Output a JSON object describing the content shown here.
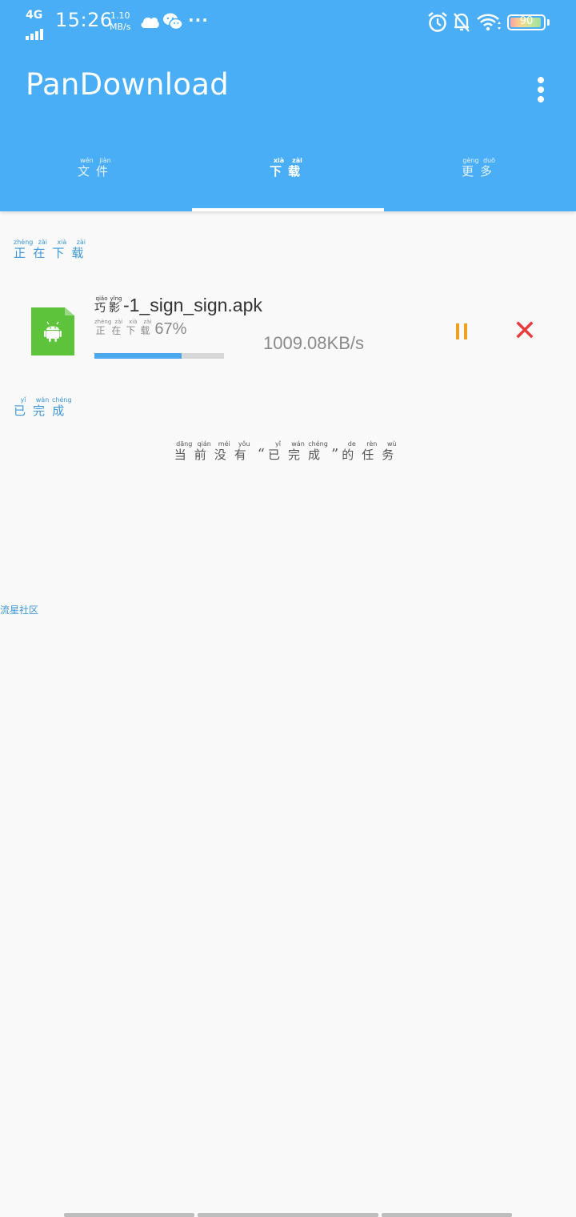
{
  "status_bar": {
    "network": "4G",
    "time": "15:26",
    "speed_value": "1.10",
    "speed_unit": "MB/s",
    "more": "···",
    "battery_level": "90"
  },
  "app": {
    "title": "PanDownload",
    "accent_color": "#4aaef7"
  },
  "tabs": [
    {
      "chars": [
        "文",
        "件"
      ],
      "pinyin": [
        "wén",
        "jiàn"
      ]
    },
    {
      "chars": [
        "下",
        "载"
      ],
      "pinyin": [
        "xià",
        "zài"
      ],
      "active": true
    },
    {
      "chars": [
        "更",
        "多"
      ],
      "pinyin": [
        "gèng",
        "duō"
      ]
    }
  ],
  "downloading": {
    "heading_chars": [
      "正",
      "在",
      "下",
      "载"
    ],
    "heading_pinyin": [
      "zhèng",
      "zài",
      "xià",
      "zài"
    ],
    "items": [
      {
        "name_chars": [
          "巧",
          "影"
        ],
        "name_pinyin": [
          "qiǎo",
          "yǐng"
        ],
        "name_suffix": "-1_sign_sign.apk",
        "status_chars": [
          "正",
          "在",
          "下",
          "载"
        ],
        "status_pinyin": [
          "zhèng",
          "zài",
          "xià",
          "zài"
        ],
        "percent_text": "67%",
        "progress": 0.67,
        "speed": "1009.08KB/s",
        "file_icon": "android-apk-icon",
        "pause_icon": "pause-icon",
        "cancel_icon": "close-icon"
      }
    ]
  },
  "completed": {
    "heading_chars": [
      "已",
      "完",
      "成"
    ],
    "heading_pinyin": [
      "yǐ",
      "wán",
      "chéng"
    ],
    "empty": {
      "pre_chars": [
        "当",
        "前",
        "没",
        "有"
      ],
      "pre_pinyin": [
        "dāng",
        "qián",
        "méi",
        "yǒu"
      ],
      "open_quote": "“",
      "quoted_chars": [
        "已",
        "完",
        "成"
      ],
      "quoted_pinyin": [
        "yǐ",
        "wán",
        "chéng"
      ],
      "close_quote": "”",
      "post_chars": [
        "的",
        "任",
        "务"
      ],
      "post_pinyin": [
        "de",
        "rèn",
        "wù"
      ]
    }
  },
  "community_link": "流星社区",
  "colors": {
    "progress": "#49a9ec",
    "pause": "#f0a020",
    "cancel": "#e83d3d",
    "section_heading": "#3d97d8",
    "apk_icon": "#5dc33a"
  }
}
